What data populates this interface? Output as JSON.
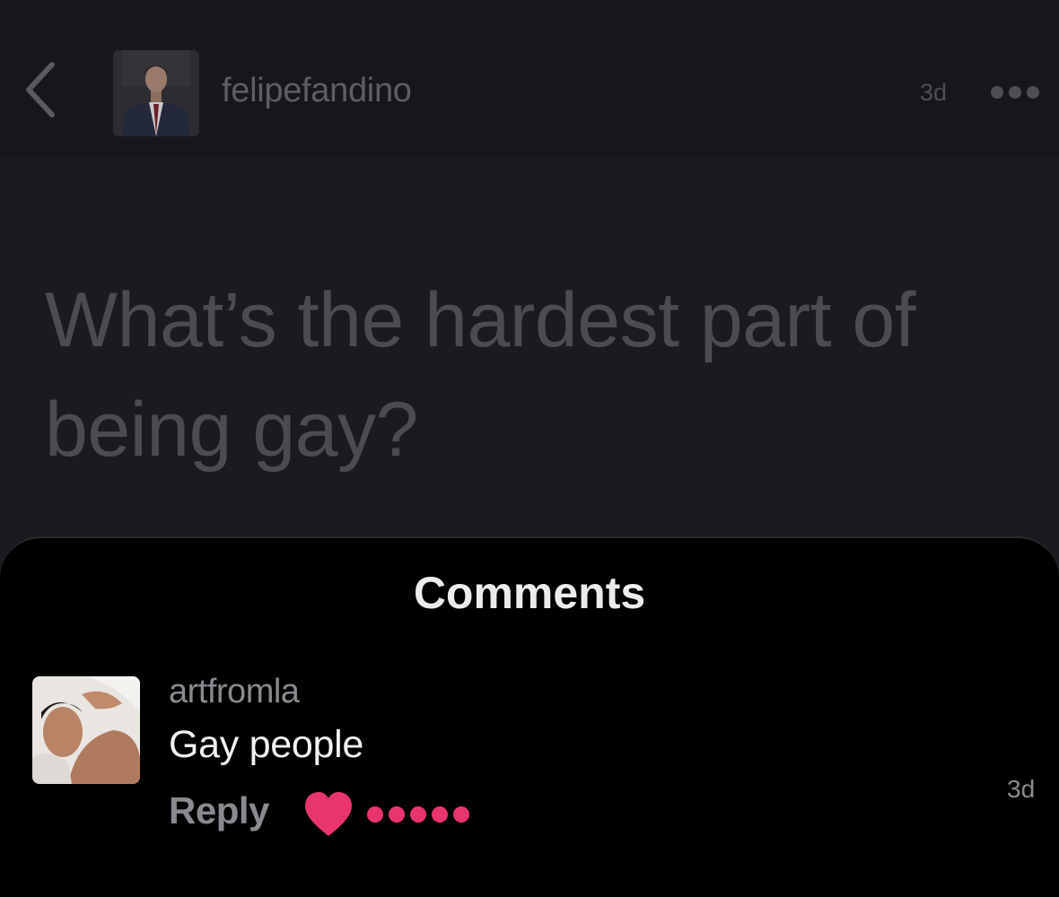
{
  "header": {
    "username": "felipefandino",
    "timestamp": "3d",
    "back_icon": "chevron-left-icon",
    "more_icon": "ellipsis-icon"
  },
  "post": {
    "question": "What’s the hardest part of being gay?"
  },
  "comments": {
    "title": "Comments",
    "items": [
      {
        "username": "artfromla",
        "text": "Gay people",
        "reply_label": "Reply",
        "timestamp": "3d",
        "reaction_icon": "heart-icon",
        "reaction_color": "#e8356d",
        "reaction_level": 5
      }
    ]
  },
  "colors": {
    "accent": "#e8356d",
    "background": "#1b1a1f",
    "sheet": "#000000"
  }
}
